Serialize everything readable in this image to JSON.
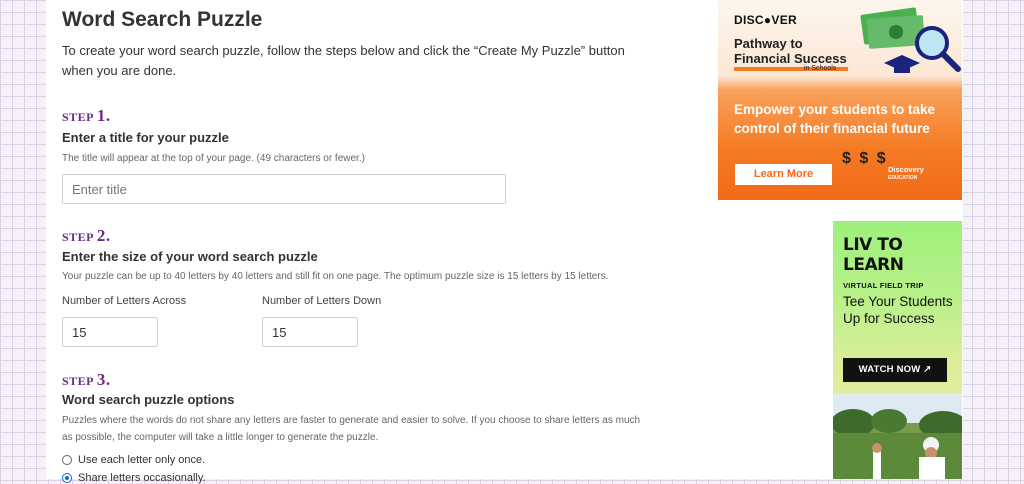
{
  "page": {
    "title": "Word Search Puzzle",
    "intro": "To create your word search puzzle, follow the steps below and click the “Create My Puzzle” button when you are done."
  },
  "step1": {
    "label": "STEP",
    "number": "1.",
    "heading": "Enter a title for your puzzle",
    "help": "The title will appear at the top of your page. (49 characters or fewer.)",
    "title_placeholder": "Enter title",
    "title_value": ""
  },
  "step2": {
    "label": "STEP",
    "number": "2.",
    "heading": "Enter the size of your word search puzzle",
    "help": "Your puzzle can be up to 40 letters by 40 letters and still fit on one page. The optimum puzzle size is 15 letters by 15 letters.",
    "across_label": "Number of Letters Across",
    "across_value": "15",
    "down_label": "Number of Letters Down",
    "down_value": "15"
  },
  "step3": {
    "label": "STEP",
    "number": "3.",
    "heading": "Word search puzzle options",
    "help": "Puzzles where the words do not share any letters are faster to generate and easier to solve. If you choose to share letters as much as possible, the computer will take a little longer to generate the puzzle.",
    "options": [
      {
        "label": "Use each letter only once.",
        "selected": false
      },
      {
        "label": "Share letters occasionally.",
        "selected": true
      }
    ]
  },
  "ad_discover": {
    "brand": "DISC●VER",
    "headline_line1": "Pathway to",
    "headline_line2": "Financial Success",
    "sub": "in Schools",
    "tagline": "Empower your students to take control of their financial future",
    "button": "Learn More",
    "dollars": "$ $ $",
    "partner_line1": "Discovery",
    "partner_line2": "EDUCATION",
    "accent": "#f47a22"
  },
  "ad_livtolearn": {
    "logo": "LIV TO LEARN",
    "kicker": "VIRTUAL FIELD TRIP",
    "headline": "Tee Your Students Up for Success",
    "button": "WATCH NOW ↗",
    "accent": "#9ef07a"
  },
  "icons": {
    "magnifier": "magnifier-icon",
    "grad_cap": "graduation-cap-icon",
    "money": "money-icon",
    "external": "arrow-up-right-icon"
  }
}
